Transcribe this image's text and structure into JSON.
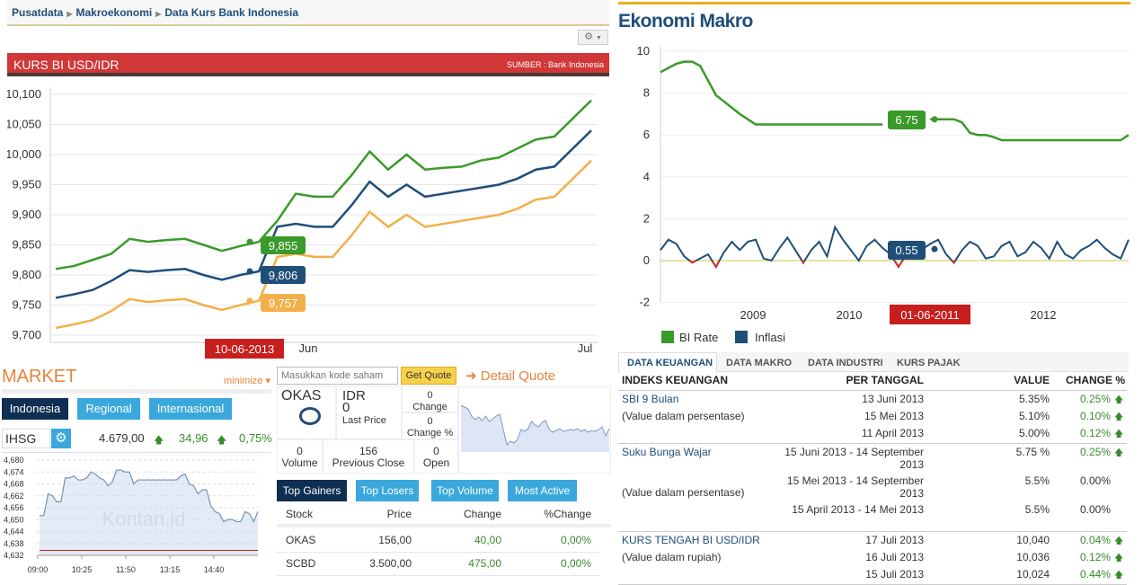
{
  "breadcrumb": [
    "Pusatdata",
    "Makroekonomi",
    "Data Kurs Bank Indonesia"
  ],
  "icons": {
    "settings": "gear-icon",
    "dropdown": "chevron-down-icon",
    "breadcrumb_sep": "triangle-right-icon",
    "up": "arrow-up-icon",
    "detail": "circle-arrow-right-icon"
  },
  "kurs": {
    "title": "KURS BI USD/IDR",
    "source": "SUMBER : Bank Indonesia"
  },
  "market": {
    "title": "MARKET",
    "minimize": "minimize",
    "tabs": [
      "Indonesia",
      "Regional",
      "Internasional"
    ],
    "index": "IHSG",
    "value": "4.679,00",
    "change": "34,96",
    "change_pct": "0,75%",
    "watermark": "Kontan.id"
  },
  "quote": {
    "placeholder": "Masukkan kode saham",
    "button": "Get Quote",
    "detail": "Detail Quote",
    "code": "OKAS",
    "currency": "IDR",
    "last_price": "0",
    "last_price_label": "Last Price",
    "change": "0",
    "change_label": "Change",
    "change_pct": "0",
    "change_pct_label": "Change %",
    "volume": "0",
    "volume_label": "Volume",
    "prev_close": "156",
    "prev_close_label": "Previous Close",
    "open": "0",
    "open_label": "Open"
  },
  "movers": {
    "tabs": [
      "Top Gainers",
      "Top Losers",
      "Top Volume",
      "Most Active"
    ],
    "columns": [
      "Stock",
      "Price",
      "Change",
      "%Change"
    ],
    "rows": [
      [
        "OKAS",
        "156,00",
        "40,00",
        "0,00%"
      ],
      [
        "SCBD",
        "3.500,00",
        "475,00",
        "0,00%"
      ]
    ]
  },
  "ekonomi": {
    "title": "Ekonomi Makro"
  },
  "keuangan": {
    "tabs": [
      "DATA KEUANGAN",
      "DATA MAKRO",
      "DATA INDUSTRI",
      "KURS PAJAK"
    ],
    "columns": [
      "INDEKS KEUANGAN",
      "PER TANGGAL",
      "VALUE",
      "CHANGE %"
    ],
    "groups": [
      {
        "name": "SBI 9 Bulan",
        "note": "(Value dalam persentase)",
        "rows": [
          [
            "13 Juni 2013",
            "5.35%",
            "0.25%",
            true
          ],
          [
            "15 Mei 2013",
            "5.10%",
            "0.10%",
            true
          ],
          [
            "11 April 2013",
            "5.00%",
            "0.12%",
            true
          ]
        ]
      },
      {
        "name": "Suku Bunga Wajar",
        "note": "(Value dalam persentase)",
        "rows": [
          [
            "15 Juni 2013 - 14 September 2013",
            "5.75 %",
            "0.25%",
            true
          ],
          [
            "15 Mei 2013 - 14 September 2013",
            "5.5%",
            "0.00%",
            false
          ],
          [
            "15 April 2013 - 14 Mei 2013",
            "5.5%",
            "0.00%",
            false
          ]
        ]
      },
      {
        "name": "KURS TENGAH BI USD/IDR",
        "note": "(Value dalam rupiah)",
        "rows": [
          [
            "17 Juli 2013",
            "10,040",
            "0.04%",
            true
          ],
          [
            "16 Juli 2013",
            "10,036",
            "0.12%",
            true
          ],
          [
            "15 Juli 2013",
            "10,024",
            "0.44%",
            true
          ]
        ]
      }
    ]
  },
  "chart_data": [
    {
      "type": "line",
      "ylim": [
        9700,
        10100
      ],
      "yticks": [
        "9,700",
        "9,750",
        "9,800",
        "9,850",
        "9,900",
        "9,950",
        "10,000",
        "10,050",
        "10,100"
      ],
      "xticks": [
        "Jun",
        "Jul"
      ],
      "crosshair_date": "10-06-2013",
      "grid": true,
      "colors": [
        "#3a9a2a",
        "#1f4e79",
        "#f2b04a"
      ],
      "series": [
        {
          "values": [
            9810,
            9815,
            9825,
            9835,
            9860,
            9855,
            9858,
            9860,
            9850,
            9840,
            9848,
            9855,
            9890,
            9935,
            9930,
            9930,
            9965,
            10005,
            9975,
            10000,
            9975,
            9978,
            9980,
            9990,
            9995,
            10010,
            10025,
            10030,
            10060,
            10090
          ],
          "tooltip": "9,855"
        },
        {
          "values": [
            9762,
            9768,
            9775,
            9790,
            9808,
            9805,
            9808,
            9810,
            9800,
            9792,
            9800,
            9806,
            9880,
            9885,
            9880,
            9880,
            9915,
            9955,
            9930,
            9950,
            9930,
            9935,
            9940,
            9945,
            9950,
            9960,
            9975,
            9980,
            10010,
            10040
          ],
          "tooltip": "9,806"
        },
        {
          "values": [
            9712,
            9718,
            9725,
            9740,
            9760,
            9755,
            9758,
            9760,
            9750,
            9742,
            9750,
            9757,
            9830,
            9835,
            9830,
            9830,
            9865,
            9905,
            9880,
            9900,
            9880,
            9885,
            9890,
            9895,
            9900,
            9910,
            9925,
            9930,
            9960,
            9990
          ],
          "tooltip": "9,757"
        }
      ]
    },
    {
      "type": "line",
      "ylim": [
        -2,
        10
      ],
      "yticks": [
        "-2",
        "0",
        "2",
        "4",
        "6",
        "8",
        "10"
      ],
      "xticks": [
        "2009",
        "2010",
        "2012"
      ],
      "crosshair_date": "01-06-2011",
      "grid": true,
      "legend": "bottom-left",
      "series": [
        {
          "name": "BI Rate",
          "color": "#3a9a2a",
          "tooltip": "6.75",
          "values": [
            9.0,
            9.2,
            9.4,
            9.5,
            9.5,
            9.3,
            8.6,
            7.9,
            7.6,
            7.3,
            7.0,
            6.75,
            6.5,
            6.5,
            6.5,
            6.5,
            6.5,
            6.5,
            6.5,
            6.5,
            6.5,
            6.5,
            6.5,
            6.5,
            6.5,
            6.5,
            6.5,
            6.5,
            6.5,
            6.5,
            6.75,
            6.75,
            6.75,
            6.75,
            6.75,
            6.75,
            6.75,
            6.75,
            6.6,
            6.1,
            6.0,
            6.0,
            5.9,
            5.75,
            5.75,
            5.75,
            5.75,
            5.75,
            5.75,
            5.75,
            5.75,
            5.75,
            5.75,
            5.75,
            5.75,
            5.75,
            5.75,
            5.75,
            5.75,
            6.0
          ]
        },
        {
          "name": "Inflasi",
          "color": "#1f4e79",
          "negative_color": "#d03030",
          "tooltip": "0.55",
          "values": [
            0.5,
            1.0,
            0.8,
            0.2,
            -0.1,
            0.1,
            0.3,
            -0.3,
            0.4,
            0.9,
            0.5,
            0.9,
            1.0,
            0.1,
            0.0,
            0.6,
            1.1,
            0.5,
            -0.1,
            0.5,
            0.9,
            0.2,
            1.6,
            1.0,
            0.5,
            0.0,
            0.7,
            1.0,
            0.6,
            0.3,
            -0.3,
            0.3,
            0.6,
            0.55,
            0.8,
            1.0,
            0.3,
            -0.1,
            0.5,
            0.9,
            0.7,
            0.1,
            0.2,
            0.7,
            0.9,
            0.2,
            0.4,
            0.9,
            0.6,
            0.1,
            0.9,
            0.3,
            0.1,
            0.5,
            0.7,
            1.0,
            0.6,
            0.3,
            0.1,
            1.0
          ]
        }
      ]
    },
    {
      "type": "area",
      "ylim": [
        4632,
        4680
      ],
      "yticks": [
        "4,632",
        "4,638",
        "4,644",
        "4,650",
        "4,656",
        "4,662",
        "4,668",
        "4,674",
        "4,680"
      ],
      "xticks": [
        "09:00",
        "10:25",
        "11:50",
        "13:15",
        "14:40"
      ],
      "reference_line": 4634.5,
      "values": [
        4652,
        4652,
        4663,
        4662,
        4659,
        4659,
        4671,
        4671,
        4672,
        4670,
        4670,
        4671,
        4674,
        4673,
        4671,
        4670,
        4667,
        4669,
        4675,
        4675,
        4674,
        4674,
        4668,
        4670,
        4670,
        4670,
        4670,
        4670,
        4670,
        4670,
        4670,
        4670,
        4670,
        4672,
        4673,
        4668,
        4667,
        4663,
        4665,
        4665,
        4657,
        4654,
        4653,
        4649,
        4650,
        4650,
        4649,
        4649,
        4654,
        4653,
        4649,
        4654
      ]
    }
  ]
}
